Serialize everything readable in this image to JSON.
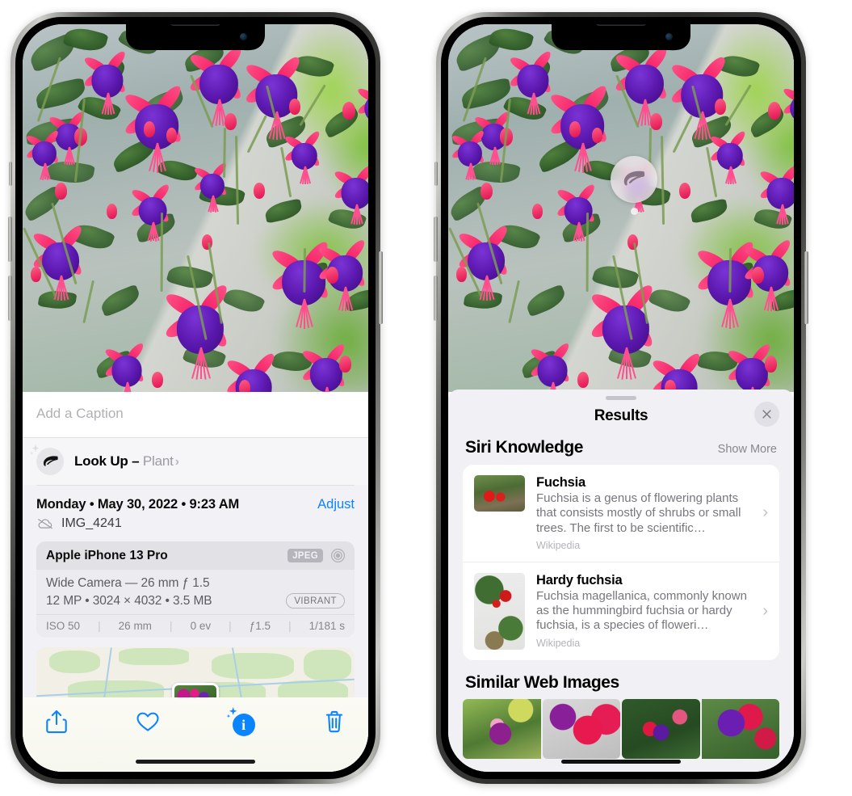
{
  "left_phone": {
    "caption_placeholder": "Add a Caption",
    "lookup": {
      "label": "Look Up –",
      "subject": "Plant",
      "chevron": "›",
      "icon": "leaf-icon"
    },
    "date_line": "Monday • May 30, 2022 • 9:23 AM",
    "adjust_label": "Adjust",
    "filename": "IMG_4241",
    "exif": {
      "model": "Apple iPhone 13 Pro",
      "format_badge": "JPEG",
      "lens_line": "Wide Camera — 26 mm ƒ 1.5",
      "size_line": "12 MP • 3024 × 4032 • 3.5 MB",
      "style_badge": "VIBRANT",
      "stats": [
        "ISO 50",
        "26 mm",
        "0 ev",
        "ƒ1.5",
        "1/181 s"
      ]
    },
    "toolbar": {
      "share": "share-icon",
      "favorite": "heart-icon",
      "info": "info-icon",
      "info_glyph": "i",
      "delete": "trash-icon"
    }
  },
  "right_phone": {
    "sheet_title": "Results",
    "close_label": "×",
    "siri_section": {
      "title": "Siri Knowledge",
      "show_more": "Show More",
      "items": [
        {
          "title": "Fuchsia",
          "description": "Fuchsia is a genus of flowering plants that consists mostly of shrubs or small trees. The first to be scientific…",
          "source": "Wikipedia",
          "chevron": "›"
        },
        {
          "title": "Hardy fuchsia",
          "description": "Fuchsia magellanica, commonly known as the hummingbird fuchsia or hardy fuchsia, is a species of floweri…",
          "source": "Wikipedia",
          "chevron": "›"
        }
      ]
    },
    "web_section": {
      "title": "Similar Web Images",
      "tiles": [
        "web-image-1",
        "web-image-2",
        "web-image-3",
        "web-image-4"
      ]
    },
    "badge": {
      "icon": "leaf-icon"
    }
  },
  "colors": {
    "accent_blue": "#0a84ff",
    "sheet_bg": "#f1f1f5",
    "card_bg": "#ffffff",
    "panel_bg": "#f2f2f6"
  }
}
